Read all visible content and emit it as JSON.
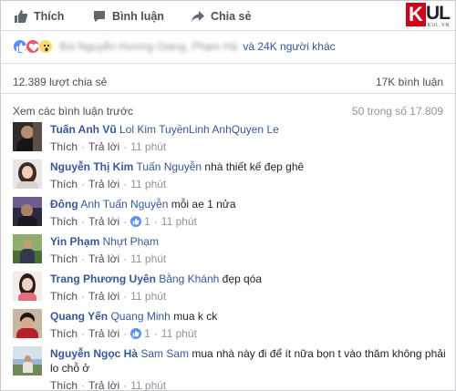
{
  "actions": {
    "like": "Thích",
    "comment": "Bình luận",
    "share": "Chia sẻ"
  },
  "logo": {
    "main_k": "K",
    "main_ul": "UL",
    "sub": "KUL.VN"
  },
  "reactions": {
    "icons": [
      "like-icon",
      "love-icon",
      "wow-icon"
    ],
    "reactors_blurred": "Bùi Nguyễn Hương Giang, Phạm Hà",
    "reactors_more": "và 24K người khác"
  },
  "stats": {
    "shares": "12.389 lượt chia sẻ",
    "comments": "17K bình luận"
  },
  "previous": {
    "link": "Xem các bình luận trước",
    "count": "50 trong số 17.809"
  },
  "labels": {
    "like": "Thích",
    "reply": "Trả lời"
  },
  "comments": [
    {
      "author": "Tuấn Anh Vũ",
      "tags": "Lol Kim TuyềnLinh AnhQuyen Le",
      "text": "",
      "time": "11 phút",
      "likes": ""
    },
    {
      "author": "Nguyễn Thị Kim",
      "tags": "Tuấn Nguyễn",
      "text": "nhà thiết kế đẹp ghê",
      "time": "11 phút",
      "likes": ""
    },
    {
      "author": "Đông",
      "tags": "Anh Tuấn Nguyễn",
      "text": "mỗi ae 1 nửa",
      "time": "11 phút",
      "likes": "1"
    },
    {
      "author": "Yin Phạm",
      "tags": "Nhựt Phạm",
      "text": "",
      "time": "11 phút",
      "likes": ""
    },
    {
      "author": "Trang Phương Uyên",
      "tags": "Bằng Khánh",
      "text": "đẹp qóa",
      "time": "11 phút",
      "likes": ""
    },
    {
      "author": "Quang Yến",
      "tags": "Quang Minh",
      "text": "mua k ck",
      "time": "11 phút",
      "likes": "1"
    },
    {
      "author": "Nguyễn Ngọc Hà",
      "tags": "Sam Sam",
      "text": "mua nhà này đi để ít nữa bọn t vào thăm không phải lo chỗ ở",
      "time": "11 phút",
      "likes": ""
    }
  ],
  "colors": {
    "link": "#365899",
    "muted": "#90949c",
    "brand_red": "#d0021b",
    "like_blue": "#5890ff"
  }
}
